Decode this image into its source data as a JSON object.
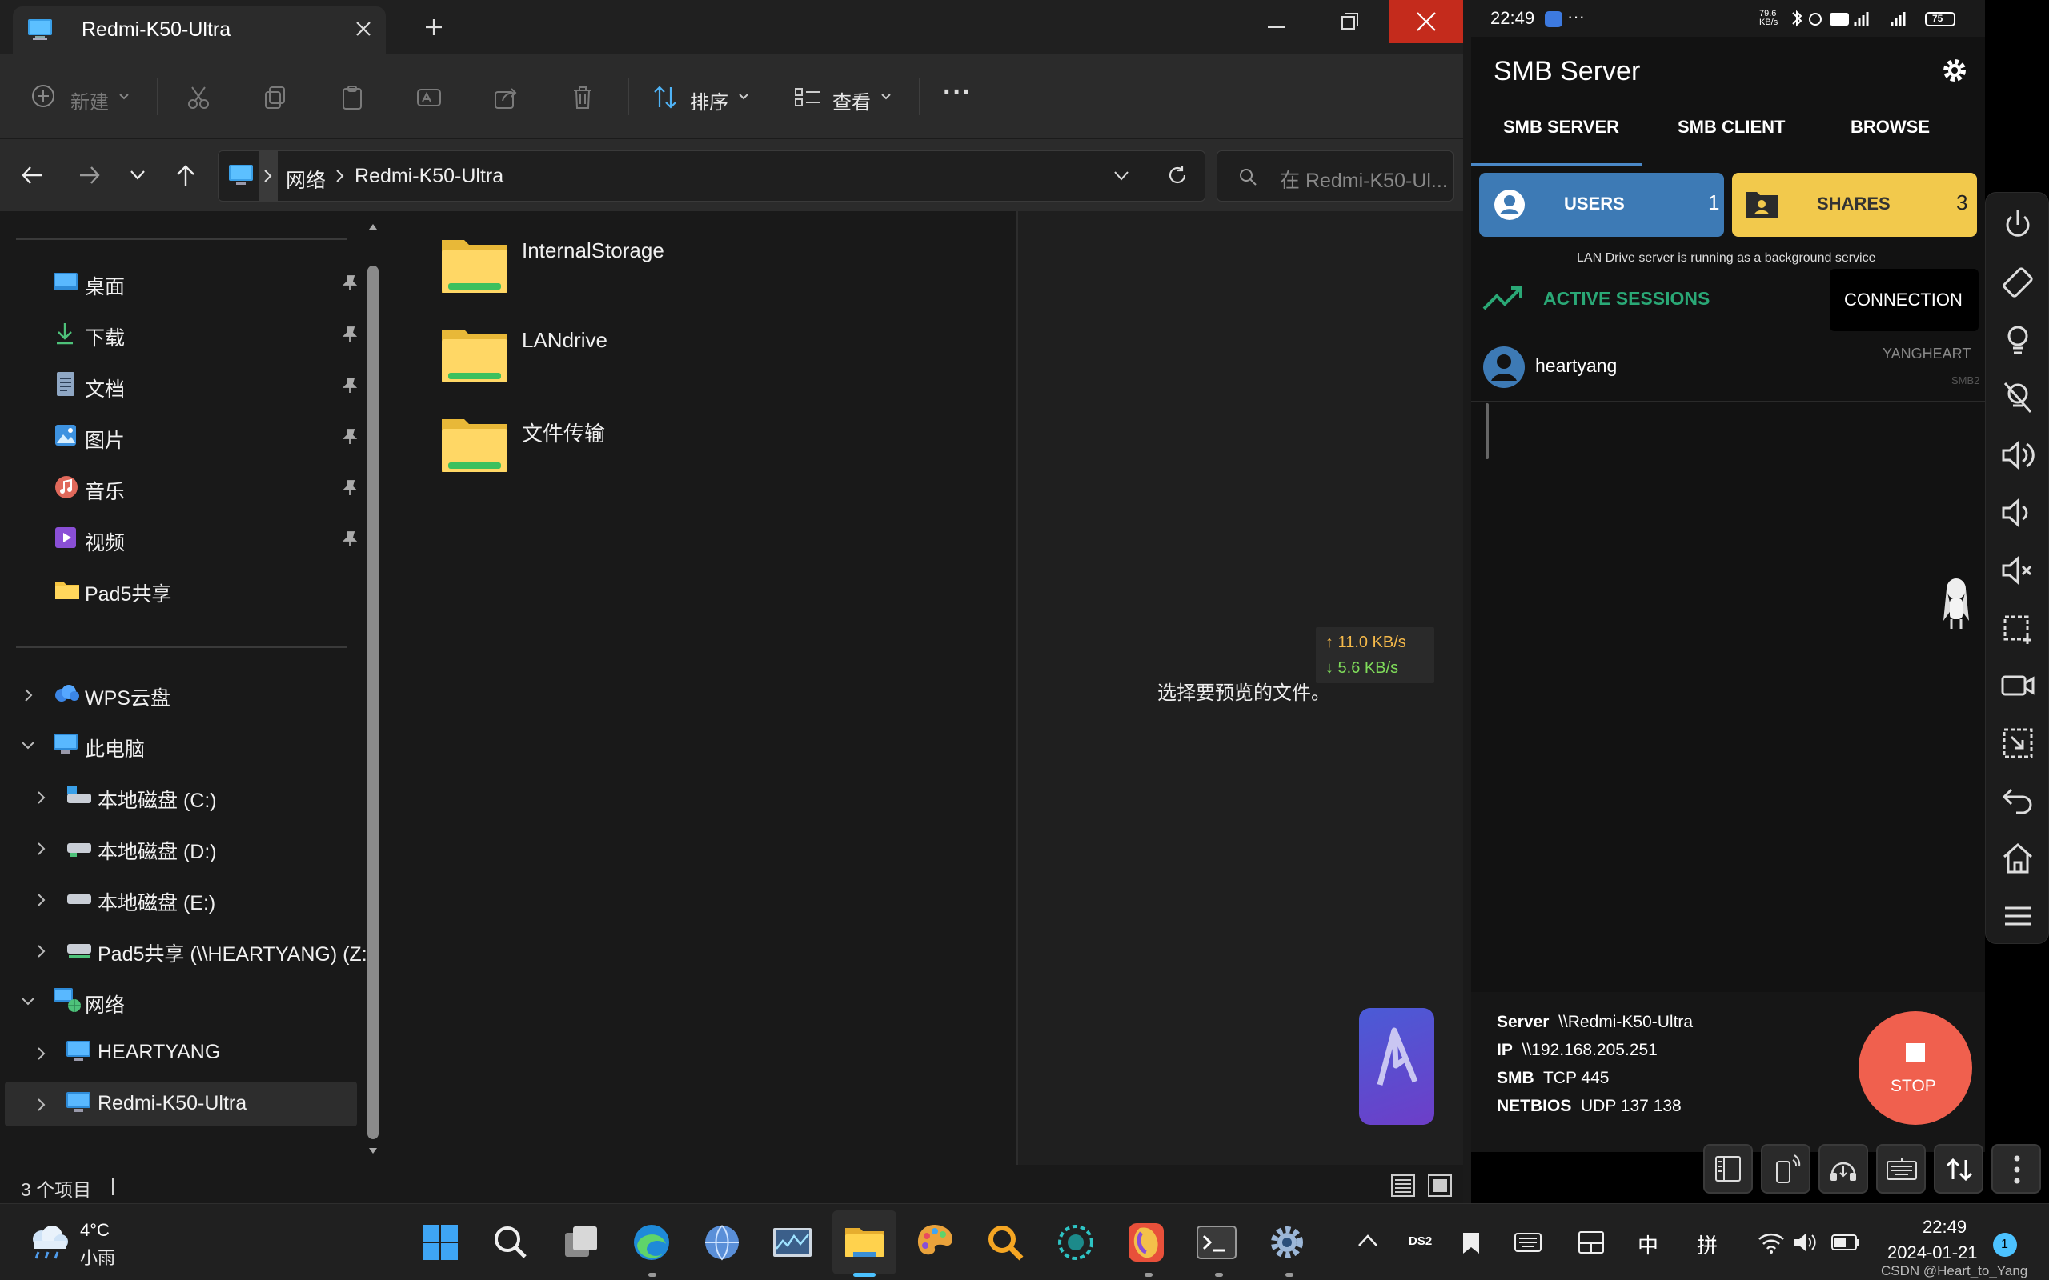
{
  "explorer": {
    "tab_title": "Redmi-K50-Ultra",
    "toolbar": {
      "new_label": "新建",
      "sort_label": "排序",
      "view_label": "查看",
      "more_label": "···"
    },
    "address": {
      "segments": [
        "网络",
        "Redmi-K50-Ultra"
      ],
      "search_placeholder": "在 Redmi-K50-Ul..."
    },
    "nav": {
      "quick": [
        {
          "label": "桌面"
        },
        {
          "label": "下载"
        },
        {
          "label": "文档"
        },
        {
          "label": "图片"
        },
        {
          "label": "音乐"
        },
        {
          "label": "视频"
        },
        {
          "label": "Pad5共享"
        }
      ],
      "tree": [
        {
          "label": "WPS云盘"
        },
        {
          "label": "此电脑"
        },
        {
          "label": "本地磁盘 (C:)"
        },
        {
          "label": "本地磁盘 (D:)"
        },
        {
          "label": "本地磁盘 (E:)"
        },
        {
          "label": "Pad5共享 (\\\\HEARTYANG) (Z:"
        },
        {
          "label": "网络"
        },
        {
          "label": "HEARTYANG"
        },
        {
          "label": "Redmi-K50-Ultra"
        }
      ]
    },
    "folders": [
      {
        "name": "InternalStorage"
      },
      {
        "name": "LANdrive"
      },
      {
        "name": "文件传输"
      }
    ],
    "preview_text": "选择要预览的文件。",
    "speed": {
      "up": "↑ 11.0 KB/s",
      "down": "↓ 5.6 KB/s"
    },
    "status_count": "3 个项目",
    "status_sep": "|"
  },
  "taskbar": {
    "weather_temp": "4°C",
    "weather_desc": "小雨",
    "tray": {
      "ds": "DS2",
      "ime1": "中",
      "ime2": "拼"
    },
    "time": "22:49",
    "date": "2024-01-21",
    "notification_count": "1"
  },
  "phone": {
    "status_time": "22:49",
    "status_more": "···",
    "status_speed": "79.6 KB/s",
    "status_battery": "75",
    "app_title": "SMB Server",
    "tabs": [
      "SMB SERVER",
      "SMB CLIENT",
      "BROWSE"
    ],
    "users_label": "USERS",
    "users_count": "1",
    "shares_label": "SHARES",
    "shares_count": "3",
    "service_note": "LAN Drive server is running as a background service",
    "active_sessions": "ACTIVE SESSIONS",
    "connection_label": "CONNECTION",
    "session_user": "heartyang",
    "session_host": "YANGHEART",
    "session_proto": "SMB2",
    "server_info": [
      {
        "key": "Server",
        "val": "\\\\Redmi-K50-Ultra"
      },
      {
        "key": "IP",
        "val": "\\\\192.168.205.251"
      },
      {
        "key": "SMB",
        "val": "TCP 445"
      },
      {
        "key": "NETBIOS",
        "val": "UDP 137 138"
      }
    ],
    "stop_label": "STOP"
  },
  "watermark": "CSDN @Heart_to_Yang",
  "colors": {
    "accent_blue": "#4a88c7",
    "users_card": "#3d7ab5",
    "shares_card": "#f2c94c",
    "active_green": "#2aa876",
    "stop_red": "#f0604e",
    "close_red": "#c42b1c"
  }
}
